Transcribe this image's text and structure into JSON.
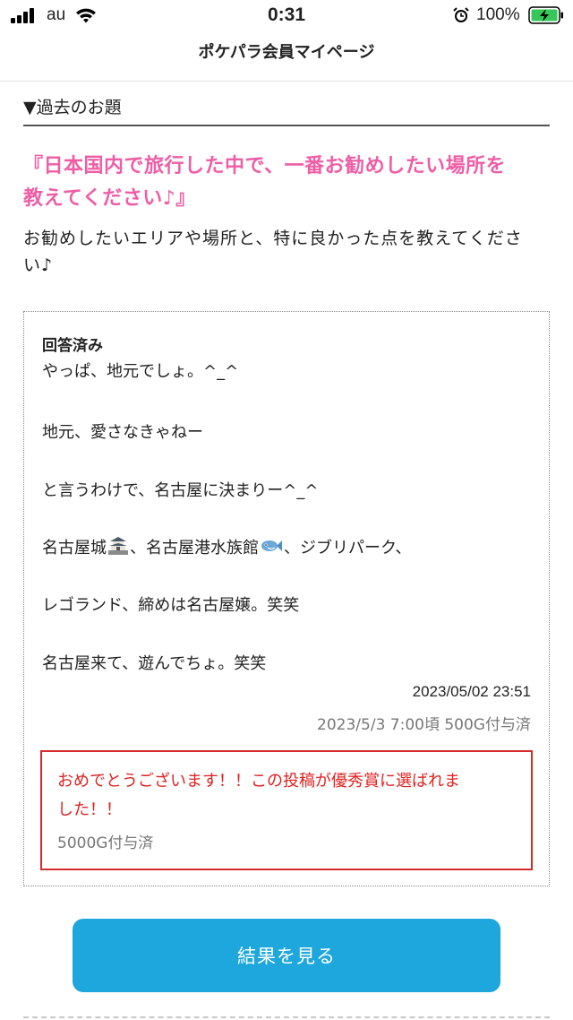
{
  "status_bar": {
    "carrier": "au",
    "time": "0:31",
    "battery_percent": "100%"
  },
  "nav": {
    "title": "ポケパラ会員マイページ"
  },
  "section": {
    "heading": "▼過去のお題"
  },
  "question": {
    "title_line1": "『日本国内で旅行した中で、一番お勧めしたい場所を",
    "title_line2": "教えてください♪』",
    "desc_line1": "お勧めしたいエリアや場所と、特に良かった点を教えてくださ",
    "desc_line2": "い♪"
  },
  "answer": {
    "status": "回答済み",
    "lines": {
      "l1": "やっぱ、地元でしょ。^_^",
      "l2": "地元、愛さなきゃねー",
      "l3": "と言うわけで、名古屋に決まりー^_^",
      "l4a": "名古屋城",
      "l4b": "、名古屋港水族館",
      "l4c": "、ジブリパーク、",
      "l5": "レゴランド、締めは名古屋嬢。笑笑",
      "l6": "名古屋来て、遊んでちょ。笑笑"
    },
    "timestamp": "2023/05/02 23:51",
    "points_note": "2023/5/3 7:00頃 500G付与済"
  },
  "award": {
    "message_line1": "おめでとうございます！！この投稿が優秀賞に選ばれま",
    "message_line2": "した！！",
    "points": "5000G付与済"
  },
  "button": {
    "label": "結果を見る"
  },
  "colors": {
    "question_pink": "#ee5ea6",
    "button_blue": "#1ea7dc",
    "award_red": "#e02020",
    "battery_green": "#35c759"
  },
  "icons": [
    "signal-icon",
    "wifi-icon",
    "alarm-icon",
    "battery-charging-icon",
    "castle-icon",
    "fish-icon"
  ]
}
